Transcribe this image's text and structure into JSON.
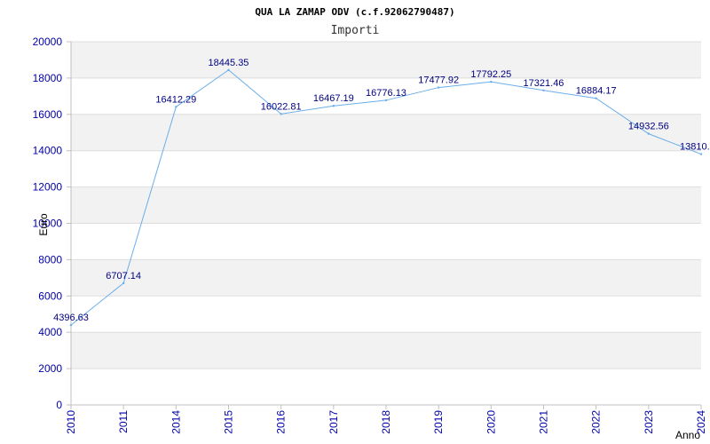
{
  "chart_data": {
    "type": "line",
    "title": "QUA LA ZAMAP ODV (c.f.92062790487)",
    "subtitle": "Importi",
    "xlabel": "Anno",
    "ylabel": "Euro",
    "categories": [
      "2010",
      "2011",
      "2014",
      "2015",
      "2016",
      "2017",
      "2018",
      "2019",
      "2020",
      "2021",
      "2022",
      "2023",
      "2024"
    ],
    "values": [
      4396.63,
      6707.14,
      16412.29,
      18445.35,
      16022.81,
      16467.19,
      16776.13,
      17477.92,
      17792.25,
      17321.46,
      16884.17,
      14932.56,
      13810.0
    ],
    "data_labels": [
      "4396.63",
      "6707.14",
      "16412.29",
      "18445.35",
      "16022.81",
      "16467.19",
      "16776.13",
      "17477.92",
      "17792.25",
      "17321.46",
      "16884.17",
      "14932.56",
      "13810."
    ],
    "ylim": [
      0,
      20000
    ],
    "yticks": [
      "0",
      "2000",
      "4000",
      "6000",
      "8000",
      "10000",
      "12000",
      "14000",
      "16000",
      "18000",
      "20000"
    ],
    "grid": true,
    "legend": "none",
    "colors": {
      "line": "#6aaee8",
      "band_shaded": "#f2f2f2",
      "band_plain": "#ffffff",
      "tick_text": "#0000a8",
      "label_text": "#000080"
    }
  }
}
